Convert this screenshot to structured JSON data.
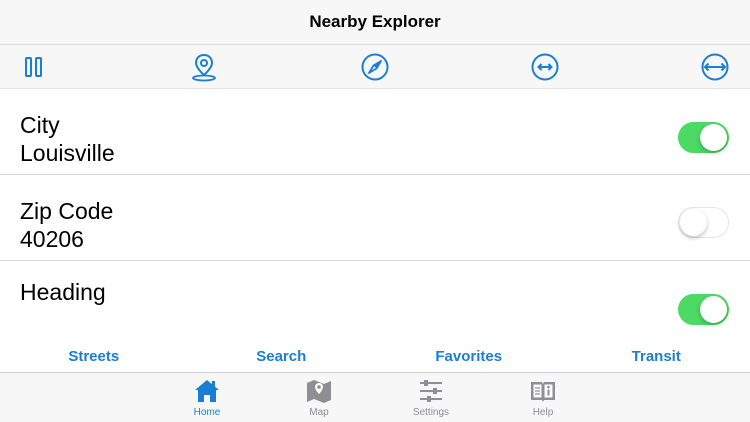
{
  "app": {
    "title": "Nearby Explorer"
  },
  "toolbar": [
    {
      "icon": "pause-icon"
    },
    {
      "icon": "location-pin-icon"
    },
    {
      "icon": "compass-icon"
    },
    {
      "icon": "small-width-icon"
    },
    {
      "icon": "wide-width-icon"
    }
  ],
  "rows": [
    {
      "label": "City",
      "value": "Louisville",
      "enabled": true
    },
    {
      "label": "Zip Code",
      "value": "40206",
      "enabled": false
    },
    {
      "label": "Heading",
      "value": "",
      "enabled": true
    }
  ],
  "quicklinks": [
    "Streets",
    "Search",
    "Favorites",
    "Transit"
  ],
  "tabs": [
    {
      "label": "Home",
      "icon": "home-icon",
      "active": true
    },
    {
      "label": "Map",
      "icon": "map-icon",
      "active": false
    },
    {
      "label": "Settings",
      "icon": "sliders-icon",
      "active": false
    },
    {
      "label": "Help",
      "icon": "help-book-icon",
      "active": false
    }
  ],
  "colors": {
    "accent": "#1a7fd4",
    "switch_on": "#4cd964",
    "inactive": "#8e8e93"
  }
}
